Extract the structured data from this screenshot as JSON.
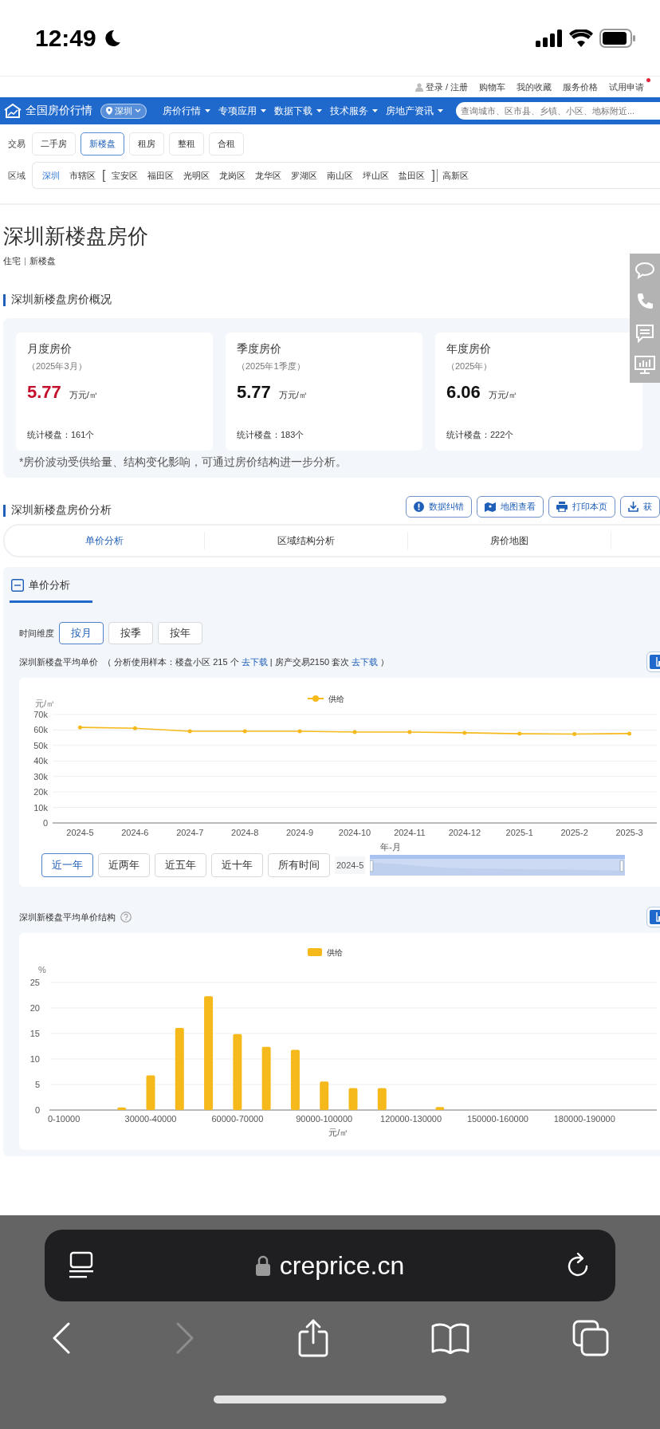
{
  "status_bar": {
    "time": "12:49"
  },
  "top_links": [
    {
      "label": "登录 / 注册",
      "kind": "user",
      "dot": false
    },
    {
      "label": "购物车",
      "kind": "plain",
      "dot": false
    },
    {
      "label": "我的收藏",
      "kind": "plain",
      "dot": false
    },
    {
      "label": "服务价格",
      "kind": "plain",
      "dot": false
    },
    {
      "label": "试用申请",
      "kind": "plain",
      "dot": true
    }
  ],
  "nav": {
    "logo": "全国房价行情",
    "city": "深圳",
    "menus": [
      "房价行情",
      "专项应用",
      "数据下载",
      "技术服务",
      "房地产资讯"
    ],
    "search": {
      "placeholder": "查询城市、区市县、乡镇、小区、地标附近..."
    }
  },
  "filters": {
    "trade_label": "交易",
    "trade_options": [
      {
        "label": "二手房",
        "selected": false
      },
      {
        "label": "新楼盘",
        "selected": true
      },
      {
        "label": "租房",
        "selected": false
      },
      {
        "label": "整租",
        "selected": false
      },
      {
        "label": "合租",
        "selected": false
      }
    ],
    "area_label": "区域",
    "areas": [
      {
        "kind": "area",
        "label": "深圳",
        "selected": true
      },
      {
        "kind": "area",
        "label": "市辖区",
        "selected": false
      },
      {
        "kind": "bracket",
        "label": "["
      },
      {
        "kind": "area",
        "label": "宝安区",
        "selected": false
      },
      {
        "kind": "area",
        "label": "福田区",
        "selected": false
      },
      {
        "kind": "area",
        "label": "光明区",
        "selected": false
      },
      {
        "kind": "area",
        "label": "龙岗区",
        "selected": false
      },
      {
        "kind": "area",
        "label": "龙华区",
        "selected": false
      },
      {
        "kind": "area",
        "label": "罗湖区",
        "selected": false
      },
      {
        "kind": "area",
        "label": "南山区",
        "selected": false
      },
      {
        "kind": "area",
        "label": "坪山区",
        "selected": false
      },
      {
        "kind": "area",
        "label": "盐田区",
        "selected": false
      },
      {
        "kind": "bracket",
        "label": "]"
      },
      {
        "kind": "divider"
      },
      {
        "kind": "area",
        "label": "高新区",
        "selected": false
      }
    ]
  },
  "page_title": "深圳新楼盘房价",
  "subtitle": [
    "住宅",
    "新楼盘"
  ],
  "overview": {
    "heading": "深圳新楼盘房价概况",
    "cards": [
      {
        "title": "月度房价",
        "period": "（2025年3月）",
        "value": "5.77",
        "color": "#c4102c",
        "unit": "万元/㎡",
        "count": "统计楼盘：161个"
      },
      {
        "title": "季度房价",
        "period": "（2025年1季度）",
        "value": "5.77",
        "color": "#111111",
        "unit": "万元/㎡",
        "count": "统计楼盘：183个"
      },
      {
        "title": "年度房价",
        "period": "（2025年）",
        "value": "6.06",
        "color": "#111111",
        "unit": "万元/㎡",
        "count": "统计楼盘：222个"
      }
    ],
    "note": "*房价波动受供给量、结构变化影响，可通过房价结构进一步分析。"
  },
  "analysis": {
    "heading": "深圳新楼盘房价分析",
    "actions": [
      {
        "kind": "alert",
        "label": "数据纠错"
      },
      {
        "kind": "map",
        "label": "地图查看"
      },
      {
        "kind": "print",
        "label": "打印本页"
      },
      {
        "kind": "download",
        "label": "获"
      }
    ],
    "tabs": [
      {
        "label": "单价分析",
        "selected": true
      },
      {
        "label": "区域结构分析",
        "selected": false
      },
      {
        "label": "房价地图",
        "selected": false
      }
    ]
  },
  "unit_panel": {
    "title": "单价分析",
    "expanded": true,
    "time_label": "时间维度",
    "time_options": [
      {
        "label": "按月",
        "selected": true
      },
      {
        "label": "按季",
        "selected": false
      },
      {
        "label": "按年",
        "selected": false
      }
    ],
    "line_title": "深圳新楼盘平均单价",
    "sample": [
      {
        "kind": "text",
        "text": "（ 分析使用样本：楼盘小区 215 个 "
      },
      {
        "kind": "link",
        "text": "去下载"
      },
      {
        "kind": "text",
        "text": " | 房产交易2150 套次 "
      },
      {
        "kind": "link",
        "text": "去下载"
      },
      {
        "kind": "text",
        "text": " ）"
      }
    ],
    "line_chart": {
      "chart_data": {
        "type": "line",
        "xlabel": "年-月",
        "ylabel": "元/㎡",
        "categories": [
          "2024-5",
          "2024-6",
          "2024-7",
          "2024-8",
          "2024-9",
          "2024-10",
          "2024-11",
          "2024-12",
          "2025-1",
          "2025-2",
          "2025-3"
        ],
        "grid": true,
        "series": [
          {
            "name": "供给",
            "color": "#f5b91c",
            "values": [
              61700,
              61100,
              59200,
              59200,
              59200,
              58700,
              58700,
              58200,
              57600,
              57400,
              57700
            ]
          }
        ],
        "ylim": [
          0,
          70000
        ],
        "yticks": [
          {
            "value": 0,
            "label": "0"
          },
          {
            "value": 10000,
            "label": "10k"
          },
          {
            "value": 20000,
            "label": "20k"
          },
          {
            "value": 30000,
            "label": "30k"
          },
          {
            "value": 40000,
            "label": "40k"
          },
          {
            "value": 50000,
            "label": "50k"
          },
          {
            "value": 60000,
            "label": "60k"
          },
          {
            "value": 70000,
            "label": "70k"
          }
        ]
      },
      "ranges": [
        {
          "label": "近一年",
          "selected": true
        },
        {
          "label": "近两年",
          "selected": false
        },
        {
          "label": "近五年",
          "selected": false
        },
        {
          "label": "近十年",
          "selected": false
        },
        {
          "label": "所有时间",
          "selected": false
        }
      ],
      "slider_label": "2024-5",
      "slider": {
        "level": 1
      }
    },
    "bar_title": "深圳新楼盘平均单价结构",
    "bar_chart": {
      "chart_data": {
        "type": "bar",
        "xlabel": "元/㎡",
        "ylabel": "%",
        "categories": [
          "0-10000",
          null,
          null,
          "30000-40000",
          null,
          null,
          "60000-70000",
          null,
          null,
          "90000-100000",
          null,
          null,
          "120000-130000",
          null,
          null,
          "150000-160000",
          null,
          null,
          "180000-190000",
          null,
          null
        ],
        "grid": true,
        "series": [
          {
            "name": "供给",
            "color": "#f5b91c",
            "values": [
              0,
              0,
              0.5,
              6.8,
              16.1,
              22.3,
              14.9,
              12.4,
              11.8,
              5.6,
              4.3,
              4.3,
              0,
              0.6,
              0,
              0,
              0,
              0,
              0,
              0,
              0
            ]
          }
        ],
        "ylim": [
          0,
          25
        ],
        "yticks": [
          0,
          5,
          10,
          15,
          20,
          25
        ]
      }
    }
  },
  "browser": {
    "url": "creprice.cn",
    "toolbar": [
      {
        "kind": "back",
        "disabled": false
      },
      {
        "kind": "forward",
        "disabled": true
      },
      {
        "kind": "share",
        "disabled": false
      },
      {
        "kind": "bookmarks",
        "disabled": false
      },
      {
        "kind": "tabs",
        "disabled": false
      }
    ]
  }
}
